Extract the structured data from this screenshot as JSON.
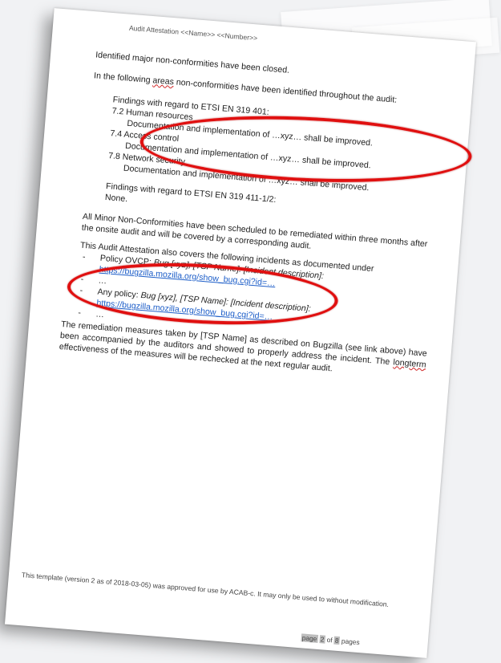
{
  "header": "Audit Attestation <<Name>> <<Number>>",
  "closed_text": "Identified major non-conformities have been closed.",
  "areas_intro": {
    "pre": "In the following ",
    "word": "areas",
    "post": " non-conformities have been identified throughout the audit:"
  },
  "findings_401": {
    "title": "Findings with regard to ETSI EN 319 401:",
    "items": [
      {
        "heading": "7.2 Human resources",
        "detail": "Documentation and implementation of …xyz… shall be improved."
      },
      {
        "heading": "7.4 Access control",
        "detail": "Documentation and implementation of …xyz… shall be improved."
      },
      {
        "heading": "7.8 Network security",
        "detail": "Documentation and implementation of …xyz… shall be improved."
      }
    ]
  },
  "findings_411": {
    "title": "Findings with regard to ETSI EN 319 411-1/2:",
    "value": "None."
  },
  "minor_text": "All Minor Non-Conformities have been scheduled to be remediated within three months after the onsite audit and will be covered by a corresponding audit.",
  "incidents": {
    "intro": "This Audit Attestation also covers the following incidents as documented under",
    "bullet": "-",
    "ellipsis": "…",
    "items": [
      {
        "policy": "Policy OVCP:",
        "ref": "Bug [xyz], [TSP Name]: [Incident description]:",
        "link": "https://bugzilla.mozilla.org/show_bug.cgi?id=…"
      },
      {
        "policy": "Any policy:",
        "ref": "Bug [xyz], [TSP Name]: [Incident description]:",
        "link": "https://bugzilla.mozilla.org/show_bug.cgi?id=…"
      }
    ]
  },
  "remediation": {
    "main": "The remediation measures taken by [TSP Name] as described on Bugzilla (see link above) have been accompanied by the auditors and showed to properly address the incident. The ",
    "word": "longterm",
    "post": " effectiveness of the measures will be rechecked at the next regular audit."
  },
  "footer": "This template (version 2 as of 2018-03-05) was approved for use by ACAB-c. It may only be used to without modification.",
  "pagination": {
    "page_label": "page",
    "current": "2",
    "of": "of",
    "total": "8",
    "suffix": "pages"
  },
  "annotation_color": "#e01010",
  "link_color": "#1c5dc8"
}
